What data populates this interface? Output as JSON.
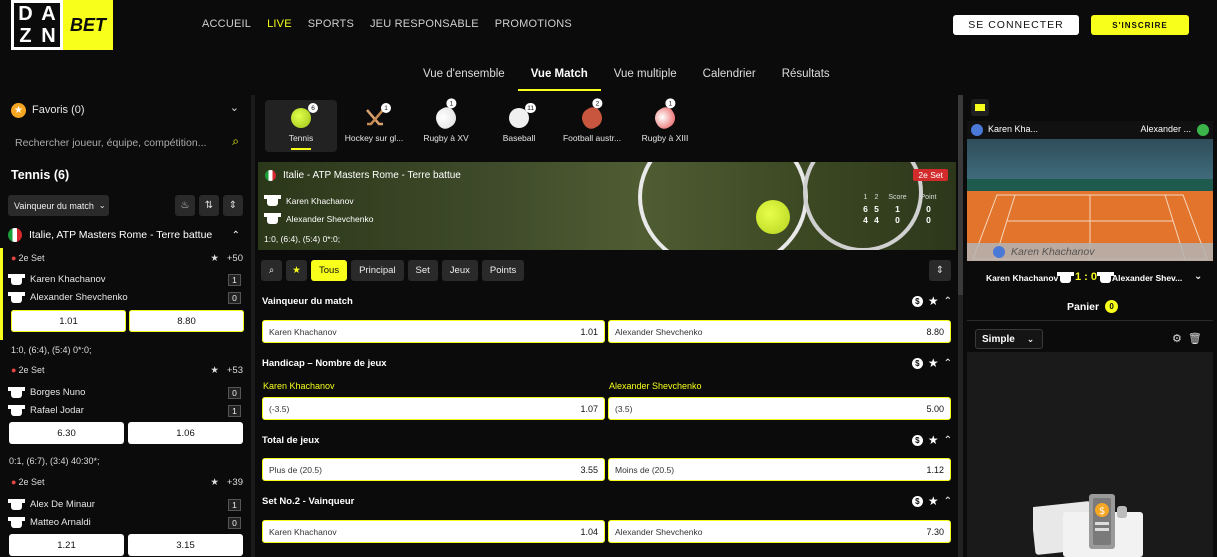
{
  "header": {
    "logo_dazn": [
      "D",
      "A",
      "Z",
      "N"
    ],
    "logo_bet": "BET",
    "nav": [
      "ACCUEIL",
      "LIVE",
      "SPORTS",
      "JEU RESPONSABLE",
      "PROMOTIONS"
    ],
    "login": "SE CONNECTER",
    "signup": "S'INSCRIRE"
  },
  "subnav": [
    "Vue d'ensemble",
    "Vue Match",
    "Vue multiple",
    "Calendrier",
    "Résultats"
  ],
  "sidebar": {
    "favorites": "Favoris (0)",
    "search_placeholder": "Rechercher joueur, équipe, compétition...",
    "title": "Tennis (6)",
    "sort": "Vainqueur du match",
    "league": "Italie, ATP Masters Rome - Terre battue",
    "matches": [
      {
        "set": "2e Set",
        "more": "+50",
        "p1": "Karen Khachanov",
        "s1": "1",
        "p2": "Alexander Shevchenko",
        "s2": "0",
        "o1": "1.01",
        "o2": "8.80",
        "score": "1:0, (6:4), (5:4) 0*:0;"
      },
      {
        "set": "2e Set",
        "more": "+53",
        "p1": "Borges Nuno",
        "s1": "0",
        "p2": "Rafael Jodar",
        "s2": "1",
        "o1": "6.30",
        "o2": "1.06",
        "score": "0:1, (6:7), (3:4) 40:30*;"
      },
      {
        "set": "2e Set",
        "more": "+39",
        "p1": "Alex De Minaur",
        "s1": "1",
        "p2": "Matteo Arnaldi",
        "s2": "0",
        "o1": "1.21",
        "o2": "3.15"
      }
    ]
  },
  "sports": [
    {
      "name": "Tennis",
      "count": "6",
      "color": "#c9e82f"
    },
    {
      "name": "Hockey sur gl...",
      "count": "1",
      "color": "#d9a06b"
    },
    {
      "name": "Rugby à XV",
      "count": "1",
      "color": "#e84b4b"
    },
    {
      "name": "Baseball",
      "count": "11",
      "color": "#f0f0f0"
    },
    {
      "name": "Football austr...",
      "count": "2",
      "color": "#c8553d"
    },
    {
      "name": "Rugby à XIII",
      "count": "1",
      "color": "#e84b4b"
    }
  ],
  "match": {
    "competition": "Italie - ATP Masters Rome - Terre battue",
    "status": "2e Set",
    "p1": "Karen Khachanov",
    "p2": "Alexander Shevchenko",
    "col1": "1",
    "col2": "2",
    "col_score": "Score",
    "col_point": "Point",
    "p1_s1": "6",
    "p1_s2": "5",
    "p1_score": "1",
    "p1_point": "0",
    "p2_s1": "4",
    "p2_s2": "4",
    "p2_score": "0",
    "p2_point": "0",
    "line": "1:0, (6:4), (5:4) 0*:0;"
  },
  "filters": [
    "Tous",
    "Principal",
    "Set",
    "Jeux",
    "Points"
  ],
  "markets": [
    {
      "title": "Vainqueur du match",
      "left": "Karen Khachanov",
      "lv": "1.01",
      "right": "Alexander Shevchenko",
      "rv": "8.80"
    },
    {
      "title": "Handicap – Nombre de jeux",
      "sub_left": "Karen Khachanov",
      "sub_right": "Alexander Shevchenko",
      "left": "(-3.5)",
      "lv": "1.07",
      "right": "(3.5)",
      "rv": "5.00"
    },
    {
      "title": "Total de jeux",
      "left": "Plus de (20.5)",
      "lv": "3.55",
      "right": "Moins de (20.5)",
      "rv": "1.12"
    },
    {
      "title": "Set No.2 - Vainqueur",
      "left": "Karen Khachanov",
      "lv": "1.04",
      "right": "Alexander Shevchenko",
      "rv": "7.30"
    }
  ],
  "right_panel": {
    "p1_short": "Karen Kha...",
    "p2_short": "Alexander ...",
    "court_label": "Karen Khachanov",
    "score_p1": "Karen Khachanov",
    "score": "1 : 0",
    "score_p2": "Alexander Shev...",
    "basket": "Panier",
    "basket_count": "0",
    "mode": "Simple"
  },
  "colors": {
    "accent": "#f7ff1a",
    "live_dot": "#e64646"
  }
}
